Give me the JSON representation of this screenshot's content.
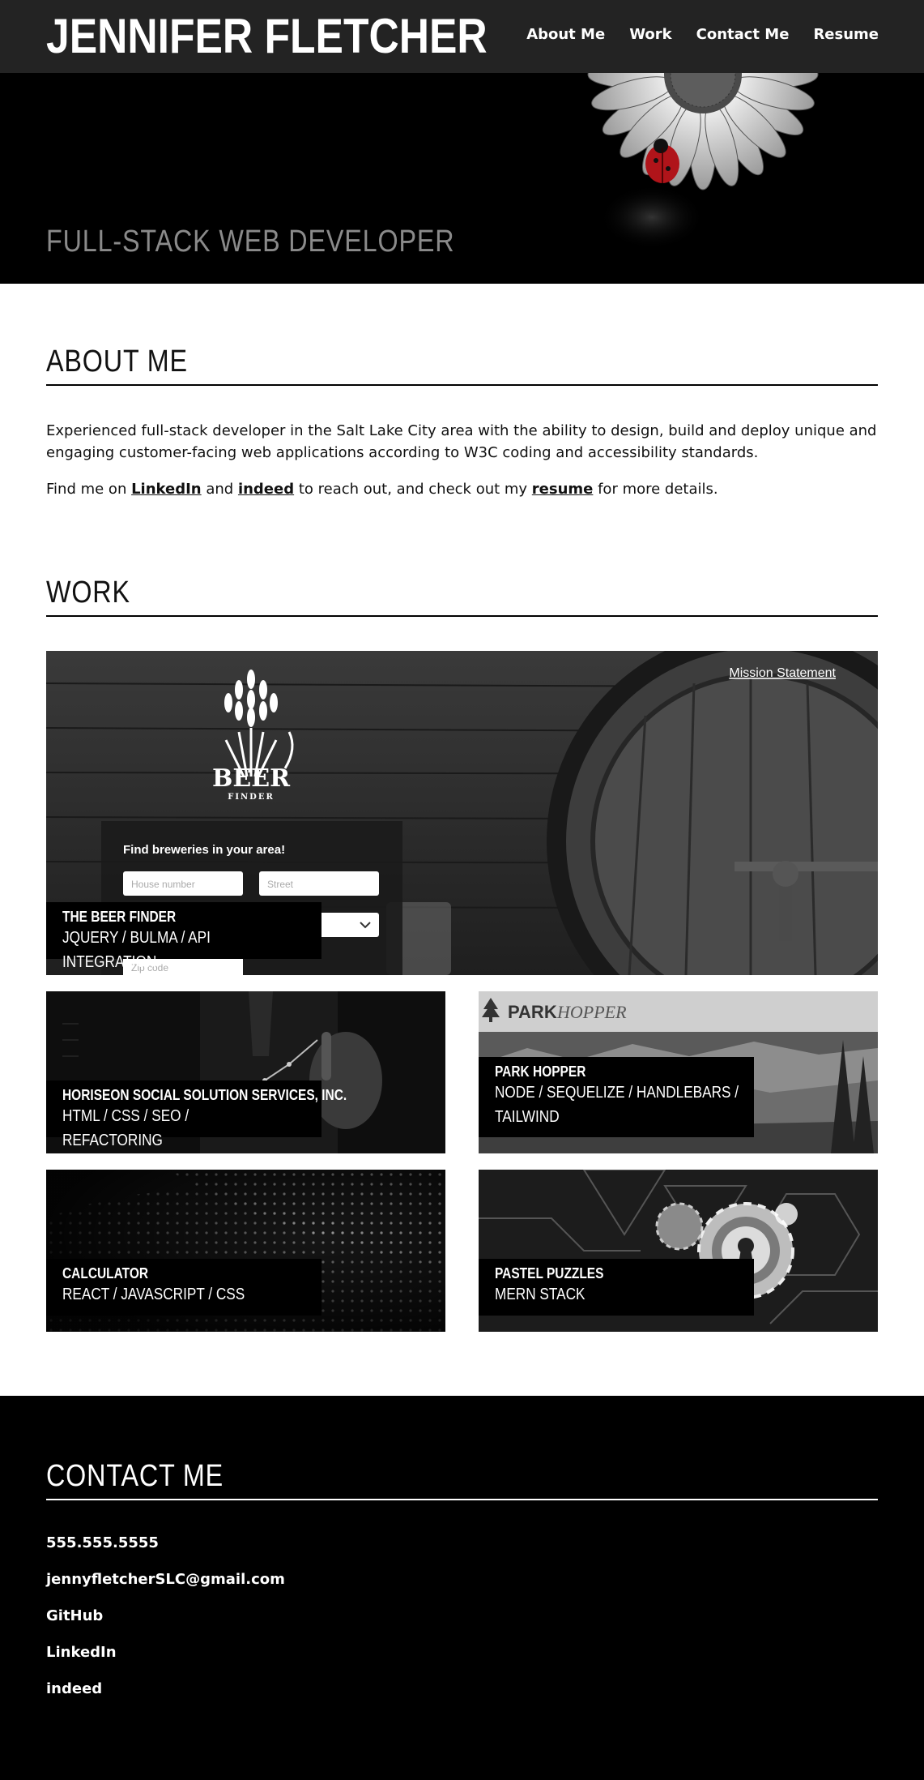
{
  "header": {
    "name": "JENNIFER FLETCHER",
    "nav": [
      "About Me",
      "Work",
      "Contact Me",
      "Resume"
    ]
  },
  "hero": {
    "subtitle": "FULL-STACK WEB DEVELOPER"
  },
  "about": {
    "title": "ABOUT ME",
    "paragraph1": "Experienced full-stack developer in the Salt Lake City area with the ability to design, build and deploy unique and engaging customer-facing web applications according to W3C coding and accessibility standards.",
    "p2_prefix": "Find me on ",
    "p2_linkedin": "LinkedIn",
    "p2_and": " and ",
    "p2_indeed": "indeed",
    "p2_mid": " to reach out, and check out my ",
    "p2_resume": "resume",
    "p2_suffix": " for more details."
  },
  "work": {
    "title": "WORK",
    "beer_finder_screenshot": {
      "mission_link": "Mission Statement",
      "logo_text": "BEER",
      "logo_sub": "FINDER",
      "form_heading": "Find breweries in your area!",
      "house_placeholder": "House number",
      "street_placeholder": "Street",
      "zip_placeholder": "Zip code"
    },
    "projects": [
      {
        "title": "THE BEER FINDER",
        "tech": "JQUERY / BULMA / API INTEGRATION"
      },
      {
        "title": "HORISEON SOCIAL SOLUTION SERVICES, INC.",
        "tech": "HTML / CSS / SEO / REFACTORING"
      },
      {
        "title": "PARK HOPPER",
        "tech": "NODE / SEQUELIZE / HANDLEBARS / TAILWIND"
      },
      {
        "title": "CALCULATOR",
        "tech": "REACT / JAVASCRIPT / CSS"
      },
      {
        "title": "PASTEL PUZZLES",
        "tech": "MERN STACK"
      }
    ],
    "park_hopper_logo": {
      "park": "PARK",
      "hopper": "HOPPER"
    }
  },
  "contact": {
    "title": "CONTACT ME",
    "items": [
      "555.555.5555",
      "jennyfletcherSLC@gmail.com",
      "GitHub",
      "LinkedIn",
      "indeed"
    ]
  }
}
